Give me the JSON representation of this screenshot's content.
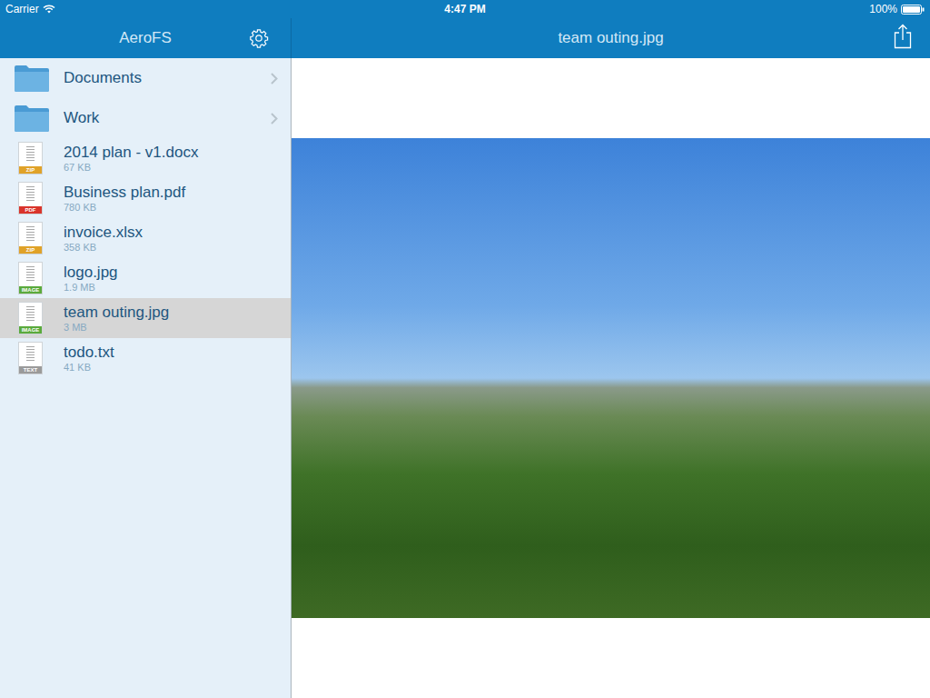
{
  "status_bar": {
    "carrier": "Carrier",
    "time": "4:47 PM",
    "battery": "100%"
  },
  "sidebar": {
    "title": "AeroFS",
    "items": [
      {
        "name": "Documents",
        "kind": "folder",
        "selected": false
      },
      {
        "name": "Work",
        "kind": "folder",
        "selected": false
      },
      {
        "name": "2014 plan - v1.docx",
        "size": "67 KB",
        "kind": "file",
        "badge": "ZIP",
        "color": "#e0a228",
        "selected": false
      },
      {
        "name": "Business plan.pdf",
        "size": "780 KB",
        "kind": "file",
        "badge": "PDF",
        "color": "#d9342b",
        "selected": false
      },
      {
        "name": "invoice.xlsx",
        "size": "358 KB",
        "kind": "file",
        "badge": "ZIP",
        "color": "#e0a228",
        "selected": false
      },
      {
        "name": "logo.jpg",
        "size": "1.9 MB",
        "kind": "file",
        "badge": "IMAGE",
        "color": "#5aaa3c",
        "selected": false
      },
      {
        "name": "team outing.jpg",
        "size": "3 MB",
        "kind": "file",
        "badge": "IMAGE",
        "color": "#5aaa3c",
        "selected": true
      },
      {
        "name": "todo.txt",
        "size": "41 KB",
        "kind": "file",
        "badge": "TEXT",
        "color": "#9a9a9a",
        "selected": false
      }
    ]
  },
  "viewer": {
    "title": "team outing.jpg"
  }
}
